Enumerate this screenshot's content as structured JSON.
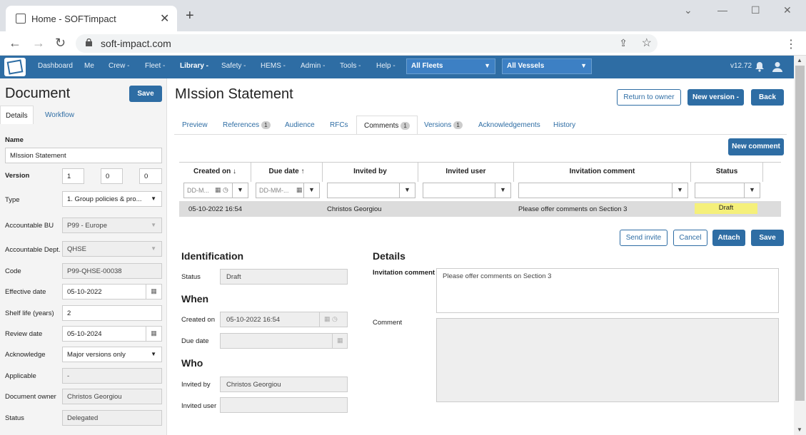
{
  "browser": {
    "tab_title": "Home - SOFTimpact",
    "url": "soft-impact.com"
  },
  "nav": {
    "items": [
      "Dashboard",
      "Me",
      "Crew -",
      "Fleet -",
      "Library -",
      "Safety -",
      "HEMS -",
      "Admin -",
      "Tools -",
      "Help -"
    ],
    "fleet_select": "All Fleets",
    "vessel_select": "All Vessels",
    "version": "v12.72"
  },
  "left": {
    "title": "Document",
    "save": "Save",
    "tabs": [
      "Details",
      "Workflow"
    ],
    "name_label": "Name",
    "name_value": "MIssion Statement",
    "version_label": "Version",
    "version_values": [
      "1",
      "0",
      "0"
    ],
    "fields": [
      {
        "label": "Type",
        "value": "1. Group policies & pro..."
      },
      {
        "label": "Accountable BU",
        "value": "P99 - Europe"
      },
      {
        "label": "Accountable Dept.",
        "value": "QHSE"
      },
      {
        "label": "Code",
        "value": "P99-QHSE-00038"
      },
      {
        "label": "Effective date",
        "value": "05-10-2022"
      },
      {
        "label": "Shelf life (years)",
        "value": "2"
      },
      {
        "label": "Review date",
        "value": "05-10-2024"
      },
      {
        "label": "Acknowledge",
        "value": "Major versions only"
      },
      {
        "label": "Applicable",
        "value": "-"
      },
      {
        "label": "Document owner",
        "value": "Christos Georgiou"
      },
      {
        "label": "Status",
        "value": "Delegated"
      }
    ]
  },
  "main": {
    "title": "MIssion Statement",
    "buttons": {
      "return": "Return to owner",
      "new_version": "New version -",
      "back": "Back",
      "new_comment": "New comment"
    },
    "tabs": [
      {
        "label": "Preview"
      },
      {
        "label": "References",
        "badge": "1"
      },
      {
        "label": "Audience"
      },
      {
        "label": "RFCs"
      },
      {
        "label": "Comments",
        "badge": "1"
      },
      {
        "label": "Versions",
        "badge": "1"
      },
      {
        "label": "Acknowledgements"
      },
      {
        "label": "History"
      }
    ],
    "table": {
      "columns": [
        "Created on ↓",
        "Due date ↑",
        "Invited by",
        "Invited user",
        "Invitation comment",
        "Status"
      ],
      "date_placeholder": "DD-M...",
      "date_placeholder2": "DD-MM-...",
      "row": {
        "created_on": "05-10-2022 16:54",
        "due_date": "",
        "invited_by": "Christos Georgiou",
        "invited_user": "",
        "comment": "Please offer comments on Section 3",
        "status": "Draft"
      }
    },
    "actions": {
      "send_invite": "Send invite",
      "cancel": "Cancel",
      "attach": "Attach",
      "save": "Save"
    },
    "identification": {
      "heading": "Identification",
      "status_label": "Status",
      "status_value": "Draft",
      "when_heading": "When",
      "created_label": "Created on",
      "created_value": "05-10-2022 16:54",
      "due_label": "Due date",
      "due_value": "",
      "who_heading": "Who",
      "invited_by_label": "Invited by",
      "invited_by_value": "Christos Georgiou",
      "invited_user_label": "Invited user",
      "invited_user_value": ""
    },
    "details": {
      "heading": "Details",
      "invitation_label": "Invitation comment",
      "invitation_value": "Please offer comments on Section 3",
      "comment_label": "Comment",
      "comment_value": ""
    }
  }
}
